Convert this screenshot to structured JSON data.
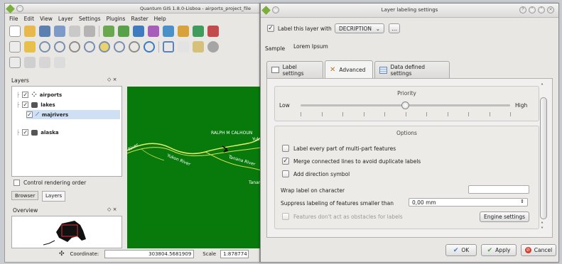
{
  "qgis": {
    "title": "Quantum GIS 1.8.0-Lisboa - airports_project_file",
    "menu": [
      "File",
      "Edit",
      "View",
      "Layer",
      "Settings",
      "Plugins",
      "Raster",
      "Help"
    ],
    "layers_title": "Layers",
    "layers": [
      {
        "name": "airports",
        "checked": true
      },
      {
        "name": "lakes",
        "checked": true
      },
      {
        "name": "majrivers",
        "checked": true
      },
      {
        "name": "alaska",
        "checked": true
      }
    ],
    "control_rendering_order": "Control rendering order",
    "tabs": [
      "Browser",
      "Layers"
    ],
    "overview_title": "Overview",
    "map_labels": [
      "RALPH M CALHOUN",
      "Yukon River",
      "Tanana River",
      "Tanan",
      "River",
      "Yuk"
    ],
    "coordinate_label": "Coordinate:",
    "coordinate_value": "303804.5681909",
    "scale_label": "Scale",
    "scale_value": "1:878774",
    "map_color": "#087a0c"
  },
  "dialog": {
    "title": "Layer labeling settings",
    "label_with_checkbox": "Label this layer with",
    "label_with_field": "DECRIPTION",
    "more_button": "...",
    "sample_label": "Sample",
    "sample_text": "Lorem Ipsum",
    "tabs": [
      "Label settings",
      "Advanced",
      "Data defined settings"
    ],
    "active_tab": "Advanced",
    "priority": {
      "title": "Priority",
      "low": "Low",
      "high": "High",
      "value_fraction": 0.5
    },
    "options": {
      "title": "Options",
      "items": [
        {
          "label": "Label every part of multi-part features",
          "checked": false,
          "enabled": true
        },
        {
          "label": "Merge connected lines to avoid duplicate labels",
          "checked": true,
          "enabled": true
        },
        {
          "label": "Add direction symbol",
          "checked": false,
          "enabled": true
        }
      ],
      "wrap_label": "Wrap label on character",
      "wrap_value": "",
      "suppress_label": "Suppress labeling of features smaller than",
      "suppress_value": "0,00 mm",
      "obstacles_label": "Features don't act as obstacles for labels",
      "obstacles_checked": false,
      "engine_button": "Engine settings"
    },
    "buttons": {
      "ok": "OK",
      "apply": "Apply",
      "cancel": "Cancel"
    }
  }
}
